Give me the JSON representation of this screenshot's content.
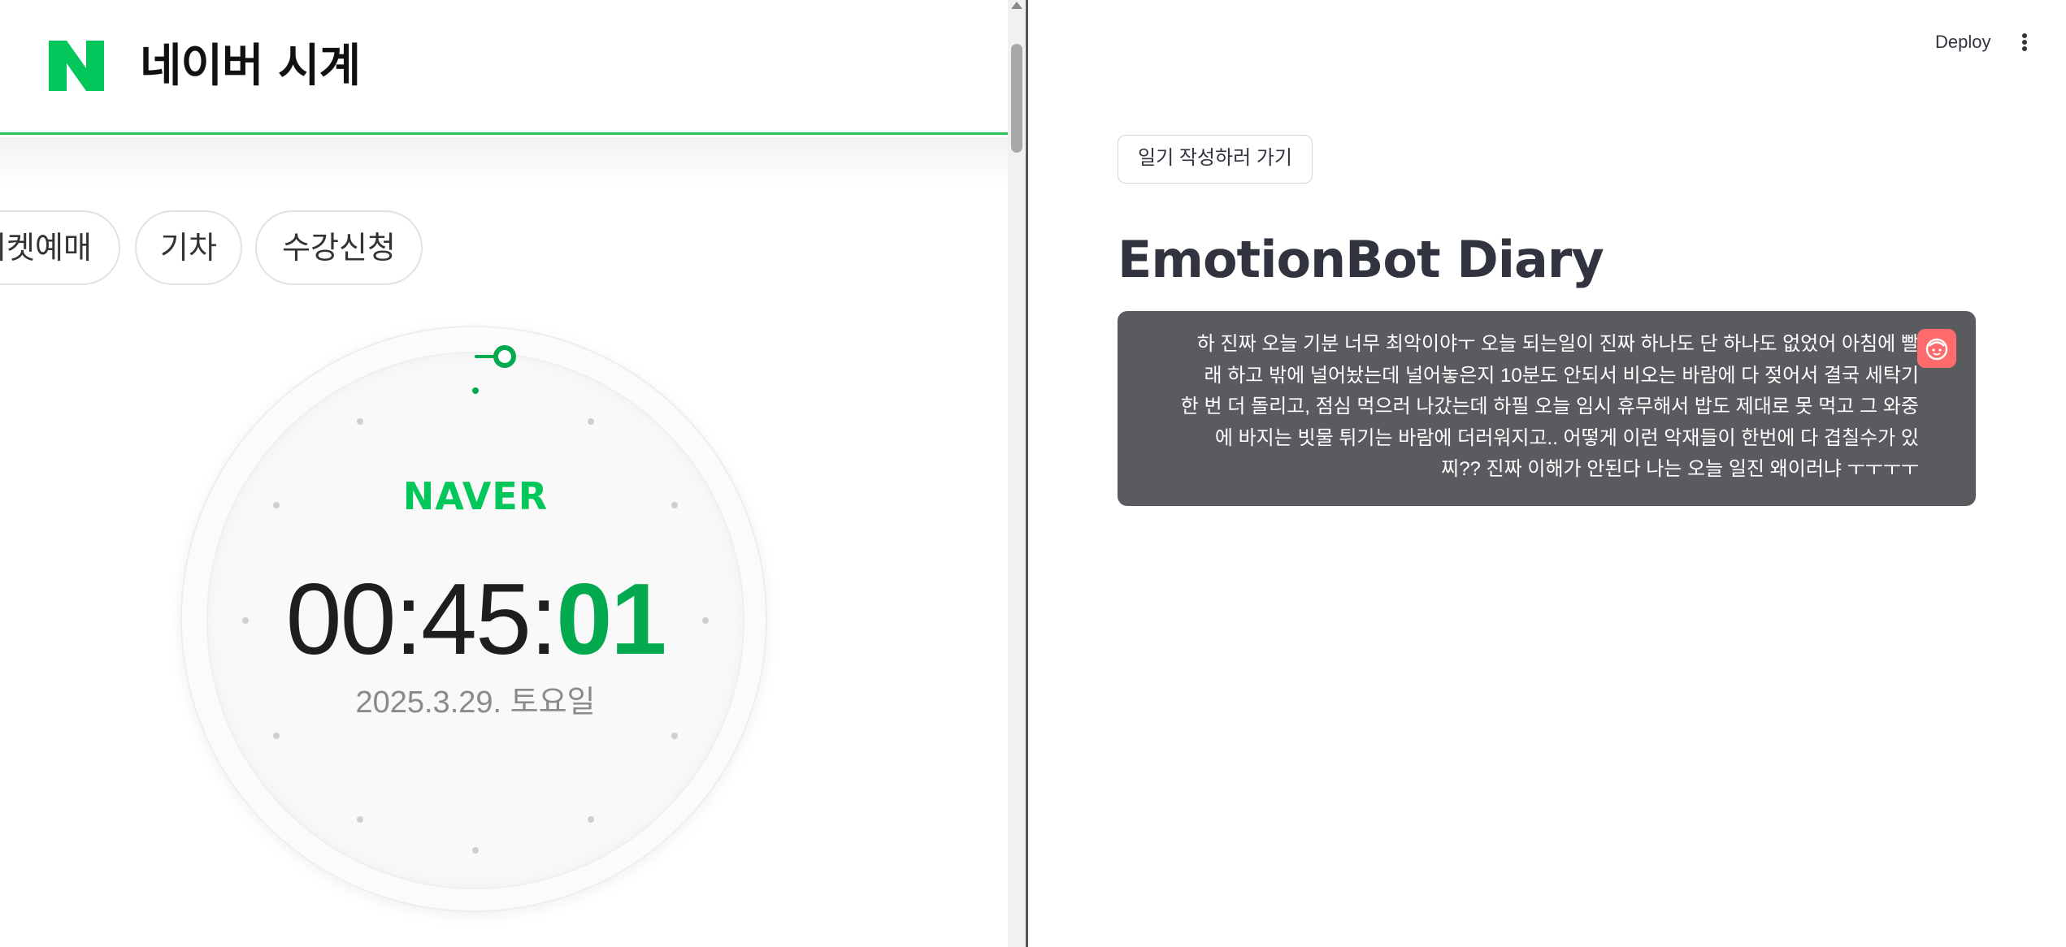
{
  "left_pane": {
    "title": "네이버 시계",
    "chips": [
      "티켓예매",
      "기차",
      "수강신청"
    ],
    "clock": {
      "brand": "NAVER",
      "hours_minutes": "00:45:",
      "seconds": "01",
      "date": "2025.3.29. 토요일"
    },
    "accent_color": "#03c75a"
  },
  "right_pane": {
    "toolbar": {
      "deploy_label": "Deploy",
      "menu_icon": "vertical-ellipsis-icon"
    },
    "nav_button_label": "일기 작성하러 가기",
    "title": "EmotionBot Diary",
    "message": {
      "text": "하 진짜 오늘 기분 너무 최악이야ㅜ 오늘 되는일이 진짜 하나도 단 하나도 없었어 아침에 빨\n래 하고 밖에 널어놨는데 널어놓은지 10분도 안되서 비오는 바람에 다 젖어서 결국 세탁기\n한 번 더 돌리고, 점심 먹으러 나갔는데 하필 오늘 임시 휴무해서 밥도 제대로 못 먹고 그 와중\n에 바지는 빗물 튀기는 바람에 더러워지고.. 어떻게 이런 악재들이 한번에 다 겹칠수가 있\n찌?? 진짜 이해가 안된다 나는 오늘 일진 왜이러냐 ㅜㅜㅜㅜ",
      "avatar_icon": "user-face-icon",
      "avatar_color": "#ff6b6b"
    }
  }
}
